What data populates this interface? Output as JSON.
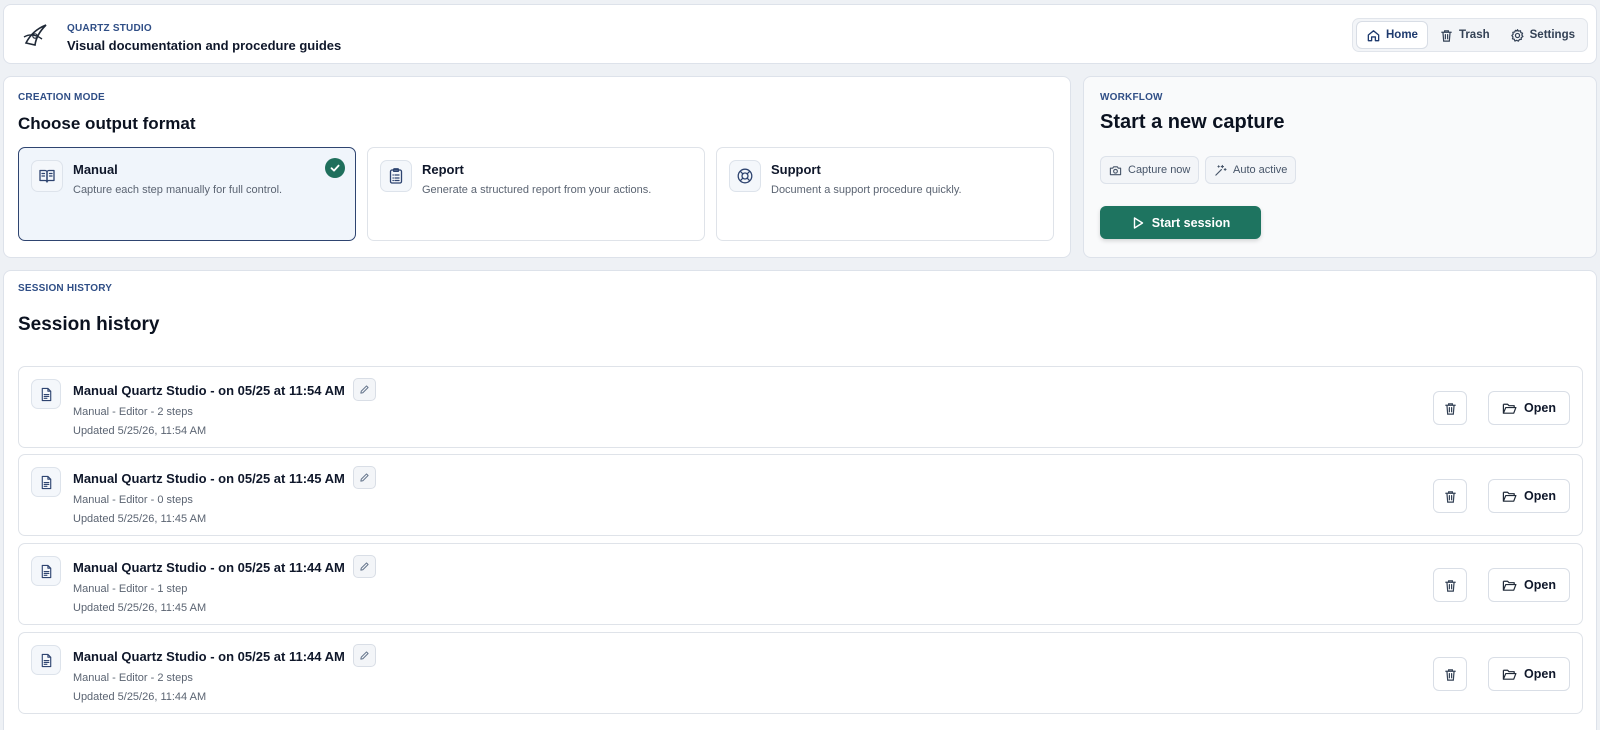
{
  "header": {
    "kicker": "QUARTZ STUDIO",
    "title": "Visual documentation and procedure guides",
    "logo_icon": "quartz-logo",
    "nav": [
      {
        "label": "Home",
        "icon": "home-icon",
        "active": true
      },
      {
        "label": "Trash",
        "icon": "trash-icon",
        "active": false
      },
      {
        "label": "Settings",
        "icon": "gear-icon",
        "active": false
      }
    ]
  },
  "creation": {
    "kicker": "CREATION MODE",
    "title": "Choose output format",
    "modes": [
      {
        "title": "Manual",
        "desc": "Capture each step manually for full control.",
        "icon": "book-icon",
        "selected": true
      },
      {
        "title": "Report",
        "desc": "Generate a structured report from your actions.",
        "icon": "clipboard-icon",
        "selected": false
      },
      {
        "title": "Support",
        "desc": "Document a support procedure quickly.",
        "icon": "lifebuoy-icon",
        "selected": false
      }
    ]
  },
  "workflow": {
    "kicker": "WORKFLOW",
    "title": "Start a new capture",
    "capture_now": "Capture now",
    "auto_active": "Auto active",
    "start_label": "Start session"
  },
  "history": {
    "kicker": "SESSION HISTORY",
    "title": "Session history",
    "open_label": "Open",
    "items": [
      {
        "title": "Manual Quartz Studio - on 05/25 at 11:54 AM",
        "meta": "Manual - Editor - 2 steps",
        "updated": "Updated 5/25/26, 11:54 AM"
      },
      {
        "title": "Manual Quartz Studio - on 05/25 at 11:45 AM",
        "meta": "Manual - Editor - 0 steps",
        "updated": "Updated 5/25/26, 11:45 AM"
      },
      {
        "title": "Manual Quartz Studio - on 05/25 at 11:44 AM",
        "meta": "Manual - Editor - 1 step",
        "updated": "Updated 5/25/26, 11:45 AM"
      },
      {
        "title": "Manual Quartz Studio - on 05/25 at 11:44 AM",
        "meta": "Manual - Editor - 2 steps",
        "updated": "Updated 5/25/26, 11:44 AM"
      }
    ]
  },
  "colors": {
    "accent": "#1e7460",
    "brand": "#2f4e86",
    "selected_border": "#2e4470"
  }
}
